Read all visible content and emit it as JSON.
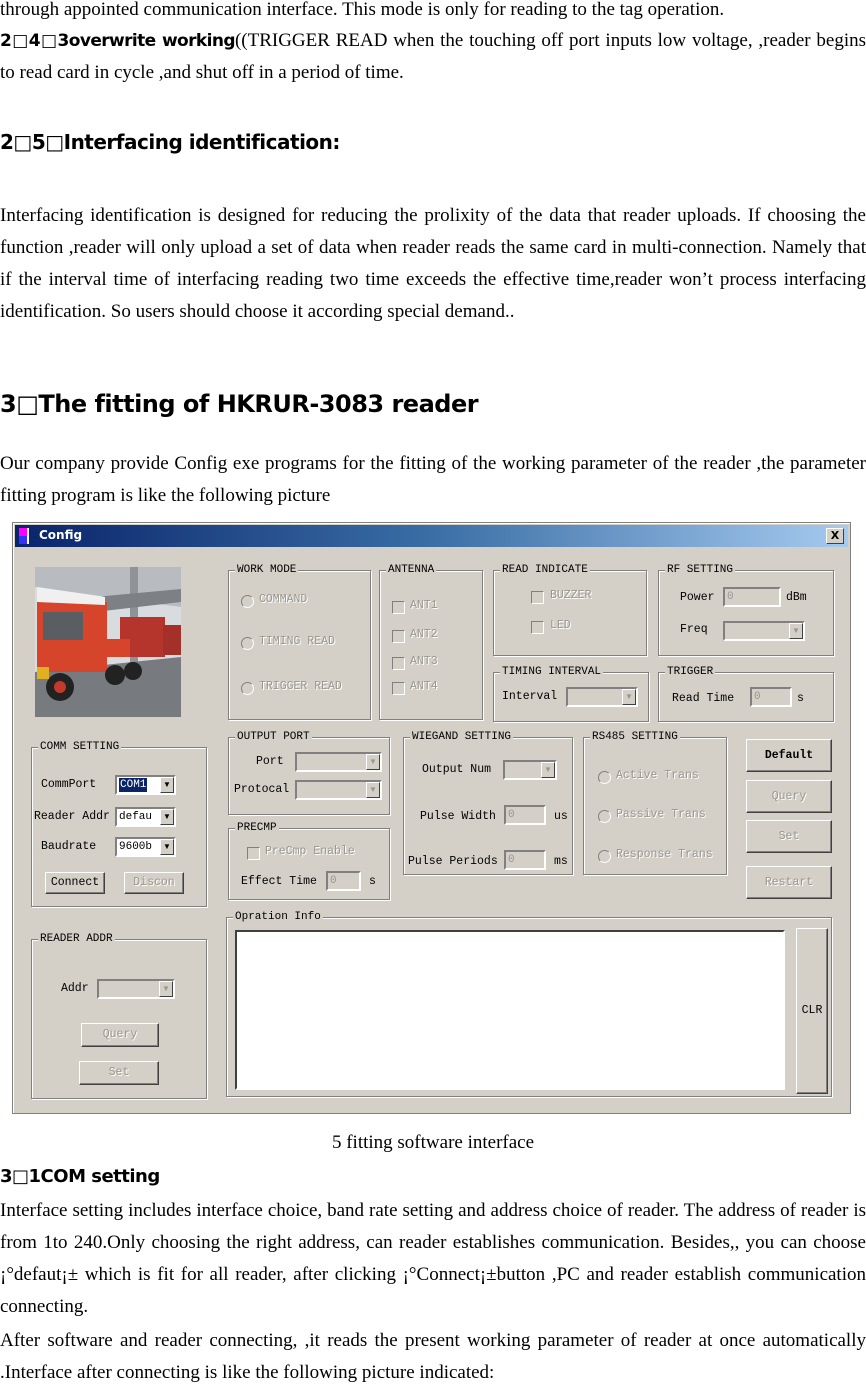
{
  "doc": {
    "line1": "through appointed communication interface. This mode is only for reading to the tag operation.",
    "sec243": {
      "heading": "2□4□3overwrite working",
      "text": "((TRIGGER READ when the touching off port inputs low voltage, ,reader begins to read card in cycle ,and shut off in a period of time."
    },
    "sec25": {
      "heading": "2□5□Interfacing identification:",
      "text": "Interfacing identification is designed for reducing the prolixity of the data that reader uploads. If choosing the function ,reader will only upload a set of data when reader reads the same card in multi-connection. Namely that if the interval time of interfacing reading two time exceeds the effective time,reader won’t process interfacing identification. So users should choose it according special demand.."
    },
    "sec3": {
      "heading": "3□The fitting of HKRUR-3083 reader",
      "text": "Our company provide Config exe programs for the fitting of the working parameter of the reader ,the parameter fitting program is like the following picture"
    },
    "caption": "5 fitting software interface",
    "sec31": {
      "heading": "3□1COM setting",
      "text1": "Interface setting includes interface choice, band rate setting and address choice of reader. The address of reader is from 1to 240.Only choosing the right address, can reader establishes communication. Besides,, you can choose ¡°defaut¡± which is fit for all reader, after clicking ¡°Connect¡±button ,PC and reader establish communication connecting.",
      "text2": "After software and reader connecting, ,it reads the present working parameter of  reader at once automatically .Interface after connecting is like the following picture indicated:"
    }
  },
  "config": {
    "title": "Config",
    "close_label": "X",
    "work_mode": {
      "title": "WORK MODE",
      "options": [
        "COMMAND",
        "TIMING READ",
        "TRIGGER READ"
      ]
    },
    "antenna": {
      "title": "ANTENNA",
      "options": [
        "ANT1",
        "ANT2",
        "ANT3",
        "ANT4"
      ]
    },
    "read_indicate": {
      "title": "READ INDICATE",
      "options": [
        "BUZZER",
        "LED"
      ]
    },
    "rf_setting": {
      "title": "RF SETTING",
      "power_label": "Power",
      "power_value": "0",
      "power_unit": "dBm",
      "freq_label": "Freq",
      "freq_value": ""
    },
    "timing_interval": {
      "title": "TIMING INTERVAL",
      "interval_label": "Interval",
      "interval_value": ""
    },
    "trigger": {
      "title": "TRIGGER",
      "read_time_label": "Read Time",
      "read_time_value": "0",
      "read_time_unit": "s"
    },
    "comm_setting": {
      "title": "COMM SETTING",
      "commport_label": "CommPort",
      "commport_value": "COM1",
      "reader_addr_label": "Reader Addr",
      "reader_addr_value": "defau",
      "baudrate_label": "Baudrate",
      "baudrate_value": "9600b",
      "connect_label": "Connect",
      "discon_label": "Discon"
    },
    "output_port": {
      "title": "OUTPUT PORT",
      "port_label": "Port",
      "port_value": "",
      "protocol_label": "Protocal",
      "protocol_value": ""
    },
    "precmp": {
      "title": "PRECMP",
      "enable_label": "PreCmp Enable",
      "effect_time_label": "Effect Time",
      "effect_time_value": "0",
      "effect_time_unit": "s"
    },
    "wiegand": {
      "title": "WIEGAND SETTING",
      "output_num_label": "Output Num",
      "output_num_value": "",
      "pulse_width_label": "Pulse Width",
      "pulse_width_value": "0",
      "pulse_width_unit": "us",
      "pulse_periods_label": "Pulse Periods",
      "pulse_periods_value": "0",
      "pulse_periods_unit": "ms"
    },
    "rs485": {
      "title": "RS485 SETTING",
      "options": [
        "Active Trans",
        "Passive Trans",
        "Response Trans"
      ]
    },
    "side_buttons": {
      "default": "Default",
      "query": "Query",
      "set": "Set",
      "restart": "Restart"
    },
    "reader_addr": {
      "title": "READER ADDR",
      "addr_label": "Addr",
      "addr_value": "",
      "query_label": "Query",
      "set_label": "Set"
    },
    "operation_info": {
      "title": "Opration Info",
      "content": "",
      "clr_label": "CLR"
    }
  }
}
